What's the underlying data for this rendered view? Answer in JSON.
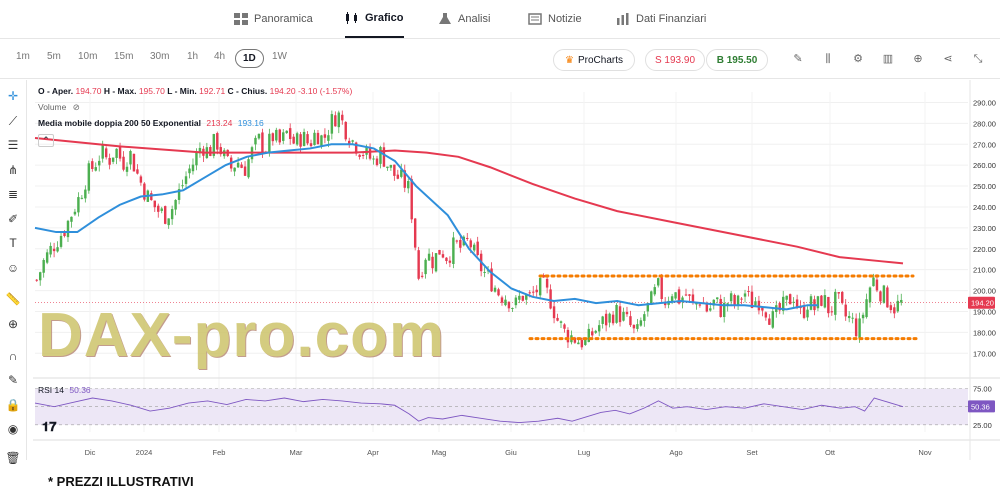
{
  "nav": {
    "tabs": [
      {
        "label": "Panoramica",
        "icon": "grid-icon"
      },
      {
        "label": "Grafico",
        "icon": "candles-icon"
      },
      {
        "label": "Analisi",
        "icon": "flask-icon"
      },
      {
        "label": "Notizie",
        "icon": "newspaper-icon"
      },
      {
        "label": "Dati Finanziari",
        "icon": "bar-chart-icon"
      }
    ],
    "active": "Grafico"
  },
  "toolbar": {
    "timeframes": [
      "1m",
      "5m",
      "10m",
      "15m",
      "30m",
      "1h",
      "4h",
      "1D",
      "1W"
    ],
    "active_timeframe": "1D",
    "prochart_label": "ProCharts",
    "sell_label": "S 193.90",
    "buy_label": "B 195.50",
    "right_icons": [
      "pencil-icon",
      "indicators-icon",
      "settings-icon",
      "compare-icon",
      "add-icon",
      "share-icon",
      "fullscreen-icon"
    ]
  },
  "left_tools": [
    "crosshair-icon",
    "trendline-icon",
    "horizontal-lines-icon",
    "pitchfork-icon",
    "fib-icon",
    "brush-icon",
    "text-icon",
    "emoji-icon",
    "ruler-icon",
    "zoom-icon",
    "magnet-icon",
    "draw-lock-icon",
    "lock-icon",
    "eye-icon",
    "trash-icon"
  ],
  "legend": {
    "ohlc_prefix": "O - Aper.",
    "open": "194.70",
    "high_label": "H - Max.",
    "high": "195.70",
    "low_label": "L - Min.",
    "low": "192.71",
    "close_label": "C - Chius.",
    "close": "194.20",
    "change": "-3.10 (-1.57%)",
    "volume_label": "Volume",
    "ma_label": "Media mobile doppia 200 50 Exponential",
    "ma200_value": "213.24",
    "ma50_value": "193.16",
    "rsi_label": "RSI 14",
    "rsi_value": "50.36"
  },
  "watermark": "DAX-pro.com",
  "footer_note": "* PREZZI ILLUSTRATIVI",
  "colors": {
    "up": "#4caf50",
    "down": "#e53950",
    "ma200": "#e53950",
    "ma50": "#2f8fdb",
    "support_resistance": "#f57c00",
    "rsi_line": "#7e57c2",
    "rsi_band": "#ede7f6"
  },
  "chart_data": {
    "type": "candlestick",
    "price_axis_ticks": [
      290,
      280,
      270,
      260,
      250,
      240,
      230,
      220,
      210,
      200,
      190,
      180,
      170
    ],
    "price_ylim": [
      162,
      295
    ],
    "last_price_label": "194.20",
    "x_tick_labels": [
      "Dic",
      "2024",
      "Feb",
      "Mar",
      "Apr",
      "Mag",
      "Giu",
      "Lug",
      "Ago",
      "Set",
      "Ott",
      "Nov"
    ],
    "rsi_axis_ticks": [
      75,
      50,
      25
    ],
    "rsi_ylim": [
      15,
      80
    ],
    "rsi_last_label": "50.36",
    "levels": [
      {
        "name": "resistance",
        "value": 207
      },
      {
        "name": "support",
        "value": 177
      }
    ],
    "ma200_points": [
      [
        0,
        273
      ],
      [
        40,
        269
      ],
      [
        80,
        266
      ],
      [
        120,
        266
      ],
      [
        150,
        266
      ],
      [
        170,
        267
      ],
      [
        185,
        266
      ],
      [
        200,
        264
      ],
      [
        215,
        259
      ],
      [
        235,
        251
      ],
      [
        255,
        244
      ],
      [
        275,
        238
      ],
      [
        300,
        233
      ],
      [
        330,
        227
      ],
      [
        360,
        221
      ],
      [
        380,
        216
      ],
      [
        400,
        214
      ],
      [
        410,
        213
      ]
    ],
    "ma50_points": [
      [
        0,
        230
      ],
      [
        10,
        228
      ],
      [
        20,
        228
      ],
      [
        30,
        235
      ],
      [
        40,
        241
      ],
      [
        50,
        245
      ],
      [
        60,
        246
      ],
      [
        70,
        248
      ],
      [
        80,
        254
      ],
      [
        90,
        260
      ],
      [
        100,
        264
      ],
      [
        110,
        266
      ],
      [
        120,
        267
      ],
      [
        130,
        268
      ],
      [
        140,
        270
      ],
      [
        150,
        270
      ],
      [
        160,
        268
      ],
      [
        170,
        262
      ],
      [
        180,
        250
      ],
      [
        195,
        236
      ],
      [
        205,
        220
      ],
      [
        215,
        209
      ],
      [
        225,
        201
      ],
      [
        235,
        197
      ],
      [
        245,
        195
      ],
      [
        255,
        196
      ],
      [
        265,
        194
      ],
      [
        275,
        195
      ],
      [
        285,
        193
      ],
      [
        295,
        194
      ],
      [
        305,
        195
      ],
      [
        315,
        194
      ],
      [
        325,
        193
      ],
      [
        335,
        193
      ],
      [
        345,
        192
      ],
      [
        355,
        191
      ],
      [
        360,
        192
      ],
      [
        365,
        193
      ],
      [
        370,
        193
      ]
    ],
    "candle_path": [
      [
        0,
        205
      ],
      [
        3,
        214
      ],
      [
        6,
        220
      ],
      [
        9,
        225
      ],
      [
        12,
        230
      ],
      [
        15,
        238
      ],
      [
        18,
        245
      ],
      [
        21,
        255
      ],
      [
        24,
        260
      ],
      [
        27,
        266
      ],
      [
        30,
        262
      ],
      [
        33,
        268
      ],
      [
        36,
        261
      ],
      [
        39,
        266
      ],
      [
        42,
        256
      ],
      [
        45,
        248
      ],
      [
        48,
        242
      ],
      [
        51,
        238
      ],
      [
        54,
        236
      ],
      [
        57,
        240
      ],
      [
        60,
        248
      ],
      [
        63,
        256
      ],
      [
        66,
        262
      ],
      [
        69,
        270
      ],
      [
        72,
        266
      ],
      [
        75,
        272
      ],
      [
        78,
        265
      ],
      [
        81,
        258
      ],
      [
        84,
        262
      ],
      [
        87,
        258
      ],
      [
        90,
        266
      ],
      [
        93,
        272
      ],
      [
        96,
        268
      ],
      [
        99,
        274
      ],
      [
        102,
        270
      ],
      [
        105,
        276
      ],
      [
        108,
        270
      ],
      [
        111,
        274
      ],
      [
        114,
        270
      ],
      [
        117,
        276
      ],
      [
        120,
        272
      ],
      [
        123,
        280
      ],
      [
        126,
        285
      ],
      [
        129,
        278
      ],
      [
        132,
        272
      ],
      [
        135,
        268
      ],
      [
        138,
        265
      ],
      [
        141,
        262
      ],
      [
        144,
        266
      ],
      [
        147,
        260
      ],
      [
        150,
        255
      ],
      [
        153,
        253
      ],
      [
        156,
        248
      ],
      [
        160,
        206
      ],
      [
        163,
        218
      ],
      [
        166,
        214
      ],
      [
        169,
        220
      ],
      [
        172,
        216
      ],
      [
        175,
        222
      ],
      [
        178,
        220
      ],
      [
        181,
        224
      ],
      [
        184,
        215
      ],
      [
        187,
        209
      ],
      [
        190,
        205
      ],
      [
        194,
        198
      ],
      [
        197,
        197
      ],
      [
        200,
        192
      ],
      [
        203,
        198
      ],
      [
        206,
        196
      ],
      [
        209,
        200
      ],
      [
        212,
        202
      ],
      [
        215,
        196
      ],
      [
        218,
        186
      ],
      [
        221,
        180
      ],
      [
        224,
        178
      ],
      [
        227,
        176
      ],
      [
        230,
        175
      ],
      [
        233,
        180
      ],
      [
        236,
        184
      ],
      [
        239,
        186
      ],
      [
        242,
        190
      ],
      [
        245,
        188
      ],
      [
        248,
        184
      ],
      [
        251,
        178
      ],
      [
        254,
        188
      ],
      [
        257,
        194
      ],
      [
        260,
        202
      ],
      [
        263,
        195
      ],
      [
        266,
        200
      ],
      [
        269,
        196
      ],
      [
        272,
        198
      ],
      [
        275,
        192
      ],
      [
        278,
        196
      ],
      [
        281,
        190
      ],
      [
        284,
        195
      ],
      [
        287,
        190
      ],
      [
        290,
        196
      ],
      [
        293,
        192
      ],
      [
        296,
        200
      ],
      [
        299,
        194
      ],
      [
        302,
        196
      ],
      [
        305,
        192
      ],
      [
        308,
        186
      ],
      [
        311,
        190
      ],
      [
        314,
        194
      ],
      [
        317,
        198
      ],
      [
        320,
        188
      ],
      [
        323,
        195
      ],
      [
        326,
        191
      ],
      [
        329,
        197
      ],
      [
        332,
        190
      ],
      [
        335,
        196
      ],
      [
        338,
        188
      ],
      [
        341,
        186
      ],
      [
        344,
        180
      ],
      [
        347,
        194
      ],
      [
        350,
        206
      ],
      [
        353,
        200
      ],
      [
        356,
        196
      ],
      [
        359,
        192
      ],
      [
        362,
        194
      ]
    ],
    "rsi_points": [
      [
        0,
        55
      ],
      [
        8,
        50
      ],
      [
        16,
        56
      ],
      [
        24,
        62
      ],
      [
        32,
        58
      ],
      [
        40,
        52
      ],
      [
        48,
        44
      ],
      [
        56,
        48
      ],
      [
        64,
        55
      ],
      [
        72,
        58
      ],
      [
        80,
        53
      ],
      [
        88,
        60
      ],
      [
        96,
        58
      ],
      [
        104,
        62
      ],
      [
        112,
        57
      ],
      [
        120,
        60
      ],
      [
        128,
        58
      ],
      [
        136,
        55
      ],
      [
        144,
        54
      ],
      [
        150,
        52
      ],
      [
        156,
        40
      ],
      [
        160,
        30
      ],
      [
        164,
        35
      ],
      [
        170,
        33
      ],
      [
        178,
        38
      ],
      [
        186,
        34
      ],
      [
        194,
        30
      ],
      [
        202,
        28
      ],
      [
        210,
        30
      ],
      [
        218,
        34
      ],
      [
        224,
        30
      ],
      [
        230,
        36
      ],
      [
        236,
        42
      ],
      [
        242,
        45
      ],
      [
        248,
        40
      ],
      [
        254,
        48
      ],
      [
        260,
        58
      ],
      [
        266,
        48
      ],
      [
        272,
        50
      ],
      [
        280,
        46
      ],
      [
        288,
        50
      ],
      [
        296,
        48
      ],
      [
        304,
        54
      ],
      [
        312,
        50
      ],
      [
        320,
        46
      ],
      [
        328,
        52
      ],
      [
        336,
        48
      ],
      [
        342,
        50
      ],
      [
        346,
        44
      ],
      [
        350,
        62
      ],
      [
        354,
        58
      ],
      [
        358,
        54
      ],
      [
        362,
        50
      ]
    ]
  }
}
